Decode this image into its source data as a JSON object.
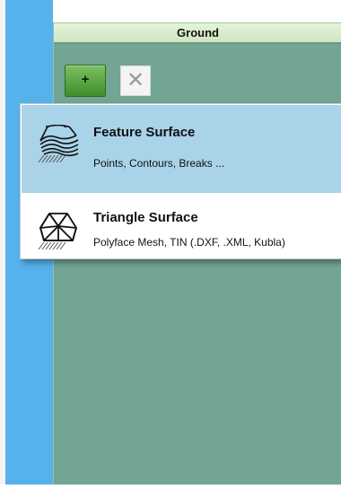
{
  "panel": {
    "title": "Ground"
  },
  "toolbar": {
    "add_label": "+",
    "delete_label": "✕"
  },
  "menu": {
    "items": [
      {
        "title": "Feature Surface",
        "subtitle": "Points, Contours, Breaks ...",
        "icon": "feature-surface-icon",
        "highlighted": true
      },
      {
        "title": "Triangle Surface",
        "subtitle": "Polyface Mesh, TIN (.DXF, .XML, Kubla)",
        "icon": "triangle-surface-icon",
        "highlighted": false
      }
    ]
  },
  "colors": {
    "desktop": "#57b2ec",
    "panel": "#72a593",
    "header": "#d9ecca",
    "highlight": "#a9d3e9",
    "add_button": "#4f9e38"
  }
}
